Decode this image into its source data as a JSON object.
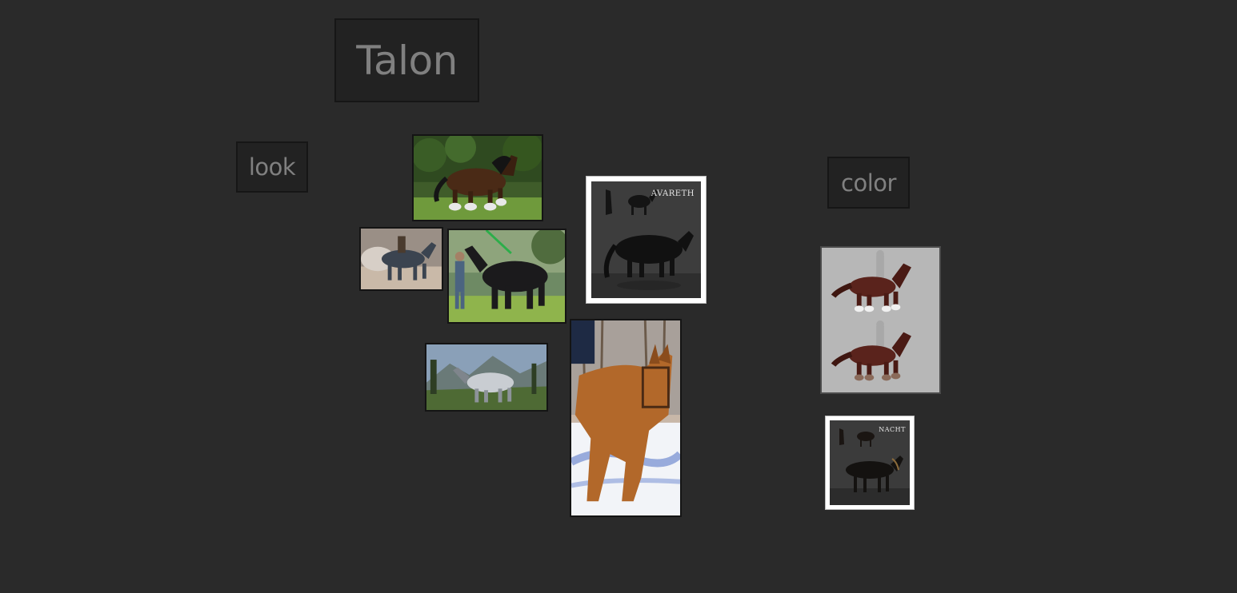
{
  "board": {
    "title": "Talon",
    "labels": {
      "look": "look",
      "color": "color"
    }
  },
  "cards": [
    {
      "id": "bay-feathered-horse-gallop",
      "scene": "bay draft horse galloping in grass, forest background"
    },
    {
      "id": "grey-horse-rider-dust",
      "scene": "grey horse with rider in dusty arena"
    },
    {
      "id": "black-draft-horse-handler",
      "scene": "black draft horse led by handler on lawn"
    },
    {
      "id": "grey-horse-mountains",
      "scene": "dappled grey horse in mountain meadow"
    },
    {
      "id": "chestnut-mule-snow",
      "scene": "chestnut mule walking in snow"
    },
    {
      "id": "avareth-reference-sheet",
      "sheet_title": "AVARETH"
    },
    {
      "id": "chestnut-horse-concept-art",
      "scene": "two chestnut horse concept renders with rider silhouettes"
    },
    {
      "id": "nacht-reference-sheet",
      "sheet_title": "NACHT"
    }
  ],
  "colors": {
    "background": "#2a2a2a",
    "label_fill": "#222222",
    "label_text": "#808080"
  }
}
